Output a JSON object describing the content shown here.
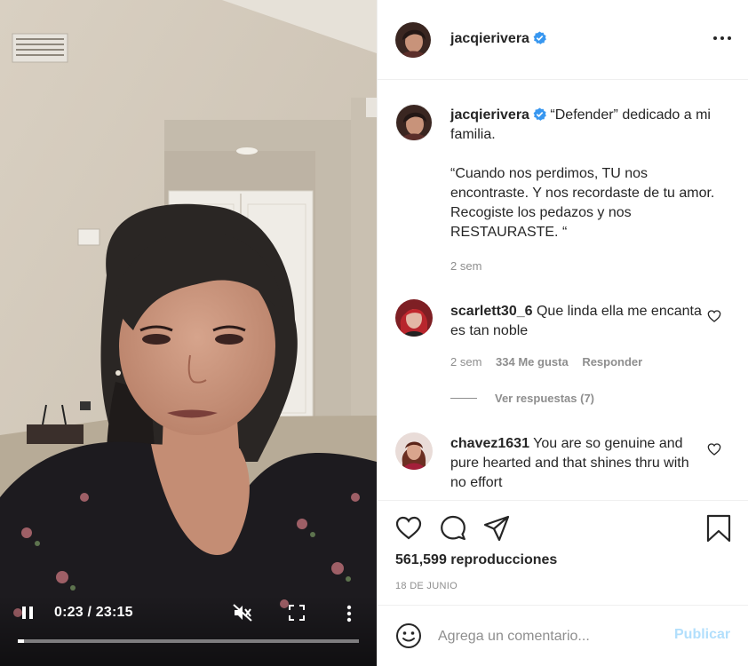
{
  "post": {
    "username": "jacqierivera",
    "verified": true
  },
  "caption": {
    "username": "jacqierivera",
    "paragraph1": "“Defender” dedicado a mi familia.",
    "paragraph2": "“Cuando nos perdimos, TU nos encontraste. Y nos recordaste de tu amor. Recogiste los pedazos y nos RESTAURASTE. “",
    "age": "2 sem"
  },
  "comments": [
    {
      "username": "scarlett30_6",
      "text": "Que linda ella me encanta es tan noble",
      "age": "2 sem",
      "likes": "334 Me gusta",
      "reply_label": "Responder",
      "view_replies": "Ver respuestas (7)"
    },
    {
      "username": "chavez1631",
      "text": "You are so genuine and pure hearted and that shines thru with no effort"
    }
  ],
  "video": {
    "time": "0:23 / 23:15",
    "progress": 0.017,
    "muted": true,
    "playing": true
  },
  "stats": {
    "views": "561,599 reproducciones",
    "date": "18 DE JUNIO"
  },
  "composer": {
    "placeholder": "Agrega un comentario...",
    "publish_label": "Publicar"
  },
  "icons": {
    "verified": "verified-badge-icon",
    "more": "more-options-icon",
    "like": "heart-icon",
    "comment": "comment-icon",
    "share": "share-icon",
    "save": "bookmark-icon",
    "emoji": "emoji-icon",
    "play_pause": "pause-icon",
    "mute": "muted-speaker-icon",
    "fullscreen": "fullscreen-icon",
    "video_more": "vertical-dots-icon"
  },
  "colors": {
    "verified_blue": "#3897f0",
    "publish_disabled": "#b2dffc",
    "muted_text": "#8e8e8e",
    "text": "#262626"
  }
}
